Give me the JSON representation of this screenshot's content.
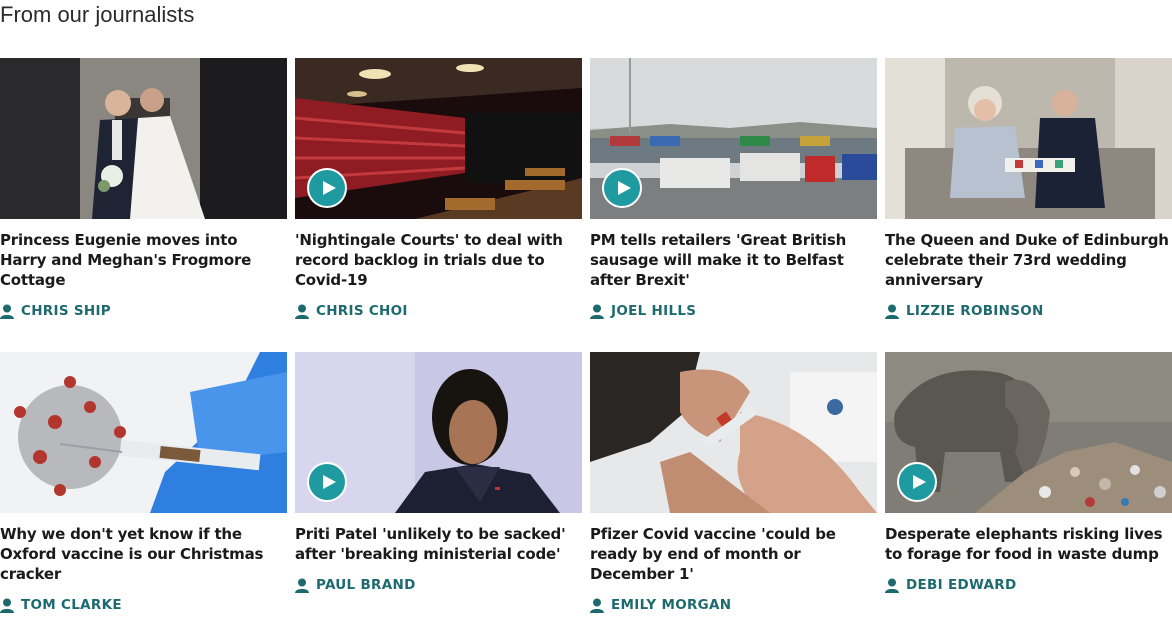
{
  "section": {
    "title": "From our journalists"
  },
  "cards": [
    {
      "headline": "Princess Eugenie moves into Harry and Meghan's Frogmore Cottage",
      "author": "CHRIS SHIP",
      "video": false,
      "image": "wedding-kiss-photo"
    },
    {
      "headline": "'Nightingale Courts' to deal with record backlog in trials due to Covid-19",
      "author": "CHRIS CHOI",
      "video": true,
      "image": "theatre-courtroom-photo"
    },
    {
      "headline": "PM tells retailers 'Great British sausage will make it to Belfast after Brexit'",
      "author": "JOEL HILLS",
      "video": true,
      "image": "port-lorries-photo"
    },
    {
      "headline": "The Queen and Duke of Edinburgh celebrate their 73rd wedding anniversary",
      "author": "LIZZIE ROBINSON",
      "video": false,
      "image": "queen-duke-sofa-photo"
    },
    {
      "headline": "Why we don't yet know if the Oxford vaccine is our Christmas cracker",
      "author": "TOM CLARKE",
      "video": false,
      "image": "virus-syringe-photo"
    },
    {
      "headline": "Priti Patel 'unlikely to be sacked' after 'breaking ministerial code'",
      "author": "PAUL BRAND",
      "video": true,
      "image": "priti-patel-portrait-photo"
    },
    {
      "headline": "Pfizer Covid vaccine 'could be ready by end of month or December 1'",
      "author": "EMILY MORGAN",
      "video": false,
      "image": "vaccine-vial-hands-photo"
    },
    {
      "headline": "Desperate elephants risking lives to forage for food in waste dump",
      "author": "DEBI EDWARD",
      "video": true,
      "image": "elephant-waste-dump-photo"
    }
  ],
  "colors": {
    "author": "#1d6a6e",
    "play_button": "#1f9aa0",
    "headline": "#1a1a1a"
  },
  "icons": {
    "play": "play-icon",
    "author": "person-icon"
  }
}
